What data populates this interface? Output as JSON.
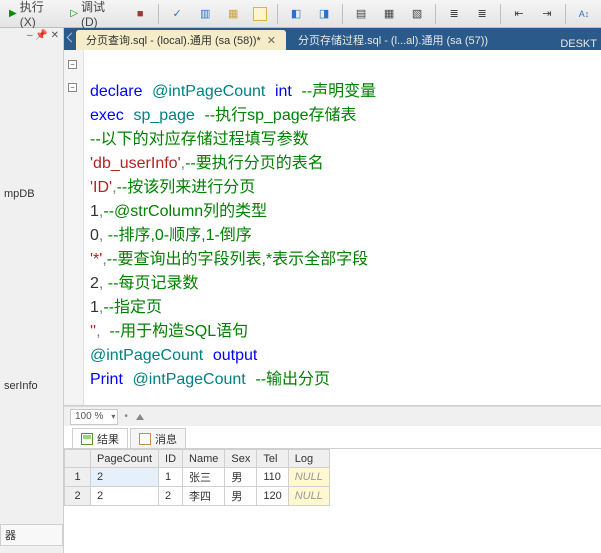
{
  "toolbar": {
    "execute_label": "执行(X)",
    "debug_label": "调试(D)"
  },
  "left_panel": {
    "pin_hint": "‒ 📌 ✕",
    "item_mpdb": "mpDB",
    "item_serinfo": "serInfo",
    "item_qi": "器"
  },
  "tabs": {
    "active": "分页查询.sql - (local).通用 (sa (58))*",
    "inactive": "分页存储过程.sql - (l...al).通用 (sa (57))",
    "right": "DESKT"
  },
  "code_tokens": {
    "l1_a": "declare",
    "l1_b": "@intPageCount",
    "l1_c": "int",
    "l1_d": "--声明变量",
    "l2_a": "exec",
    "l2_b": "sp_page",
    "l2_c": "--执行sp_page存储表",
    "l3": "--以下的对应存储过程填写参数",
    "l4_a": "'db_userInfo'",
    "l4_b": ",",
    "l4_c": "--要执行分页的表名",
    "l5_a": "'ID'",
    "l5_b": ",",
    "l5_c": "--按该列来进行分页",
    "l6_a": "1",
    "l6_b": ",",
    "l6_c": "--@strColumn列的类型",
    "l7_a": "0",
    "l7_b": ",",
    "l7_c": " --排序,0-顺序,1-倒序",
    "l8_a": "'*'",
    "l8_b": ",",
    "l8_c": "--要查询出的字段列表,*表示全部字段",
    "l9_a": "2",
    "l9_b": ",",
    "l9_c": " --每页记录数",
    "l10_a": "1",
    "l10_b": ",",
    "l10_c": "--指定页",
    "l11_a": "''",
    "l11_b": ",",
    "l11_c": "  --用于构造SQL语句",
    "l12_a": "@intPageCount",
    "l12_b": "output",
    "l13_a": "Print",
    "l13_b": "@intPageCount",
    "l13_c": "--输出分页"
  },
  "zoom": {
    "value": "100 %"
  },
  "result_tabs": {
    "results": "结果",
    "messages": "消息"
  },
  "grid": {
    "columns": [
      "PageCount",
      "ID",
      "Name",
      "Sex",
      "Tel",
      "Log"
    ],
    "rows": [
      {
        "n": "1",
        "PageCount": "2",
        "ID": "1",
        "Name": "张三",
        "Sex": "男",
        "Tel": "110",
        "Log": "NULL"
      },
      {
        "n": "2",
        "PageCount": "2",
        "ID": "2",
        "Name": "李四",
        "Sex": "男",
        "Tel": "120",
        "Log": "NULL"
      }
    ]
  }
}
